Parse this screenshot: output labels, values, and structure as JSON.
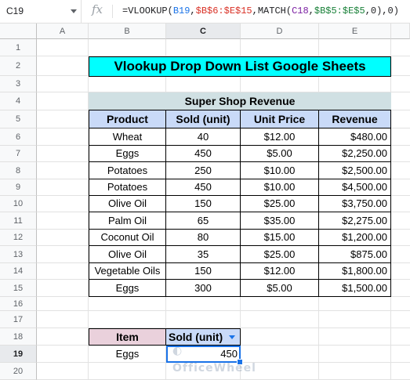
{
  "formula_bar": {
    "cell_ref": "C19",
    "fx": "fx",
    "formula_parts": {
      "p1": "=VLOOKUP(",
      "p2": "B19",
      "p3": ",",
      "p4": "$B$6:$E$15",
      "p5": ",MATCH(",
      "p6": "C18",
      "p7": ",",
      "p8": "$B$5:$E$5",
      "p9": ",0),0)"
    }
  },
  "columns": [
    "A",
    "B",
    "C",
    "D",
    "E"
  ],
  "rows": [
    "1",
    "2",
    "3",
    "4",
    "5",
    "6",
    "7",
    "8",
    "9",
    "10",
    "11",
    "12",
    "13",
    "14",
    "15",
    "16",
    "17",
    "18",
    "19",
    "20"
  ],
  "title": "Vlookup Drop Down List Google Sheets",
  "table": {
    "title": "Super Shop Revenue",
    "headers": [
      "Product",
      "Sold (unit)",
      "Unit Price",
      "Revenue"
    ],
    "rows": [
      [
        "Wheat",
        "40",
        "$12.00",
        "$480.00"
      ],
      [
        "Eggs",
        "450",
        "$5.00",
        "$2,250.00"
      ],
      [
        "Potatoes",
        "250",
        "$10.00",
        "$2,500.00"
      ],
      [
        "Potatoes",
        "450",
        "$10.00",
        "$4,500.00"
      ],
      [
        "Olive Oil",
        "150",
        "$25.00",
        "$3,750.00"
      ],
      [
        "Palm Oil",
        "65",
        "$35.00",
        "$2,275.00"
      ],
      [
        "Coconut Oil",
        "80",
        "$15.00",
        "$1,200.00"
      ],
      [
        "Olive Oil",
        "35",
        "$25.00",
        "$875.00"
      ],
      [
        "Vegetable Oils",
        "150",
        "$12.00",
        "$1,800.00"
      ],
      [
        "Eggs",
        "300",
        "$5.00",
        "$1,500.00"
      ]
    ]
  },
  "lookup": {
    "item_header": "Item",
    "sold_header": "Sold (unit)",
    "item_value": "Eggs",
    "result_value": "450"
  },
  "watermark": "OfficeWheel",
  "colors": {
    "title_bg": "#00ffff",
    "table_title_bg": "#d0e0e3",
    "header_bg": "#c9daf8",
    "item_header_bg": "#ead1dc",
    "selection": "#1a73e8"
  }
}
